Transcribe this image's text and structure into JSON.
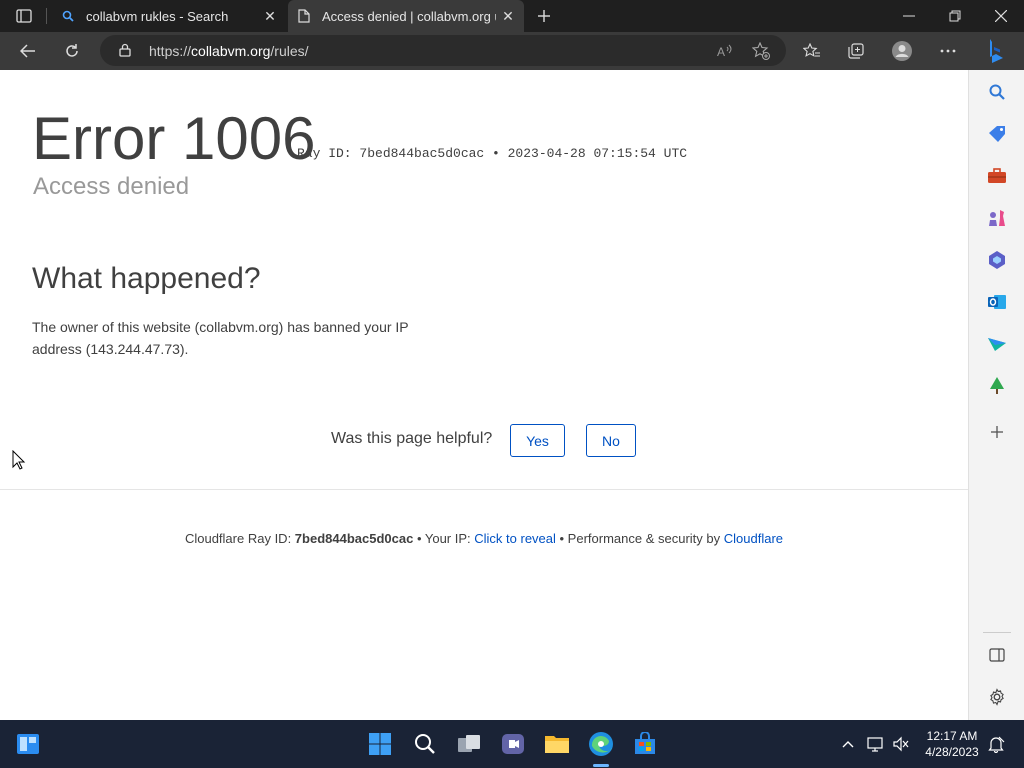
{
  "browser": {
    "tabs": [
      {
        "label": "collabvm rukles - Search",
        "icon": "search-icon"
      },
      {
        "label": "Access denied | collabvm.org use",
        "icon": "page-icon"
      }
    ],
    "url_prefix": "https://",
    "url_host": "collabvm.org",
    "url_path": "/rules/"
  },
  "page": {
    "error_title": "Error 1006",
    "ray_line": "Ray ID: 7bed844bac5d0cac • 2023-04-28 07:15:54 UTC",
    "subtitle": "Access denied",
    "what_heading": "What happened?",
    "what_body": "The owner of this website (collabvm.org) has banned your IP address (143.244.47.73).",
    "helpful_question": "Was this page helpful?",
    "yes_label": "Yes",
    "no_label": "No",
    "footer": {
      "ray_prefix": "Cloudflare Ray ID: ",
      "ray_id": "7bed844bac5d0cac",
      "ip_prefix": " • Your IP: ",
      "ip_link": "Click to reveal",
      "perf_prefix": " • Performance & security by ",
      "cloudflare_link": "Cloudflare"
    }
  },
  "taskbar": {
    "time": "12:17 AM",
    "date": "4/28/2023"
  },
  "colors": {
    "link": "#0051c3",
    "tab_bg": "#1f1f1f",
    "taskbar_bg": "#1a2336"
  }
}
